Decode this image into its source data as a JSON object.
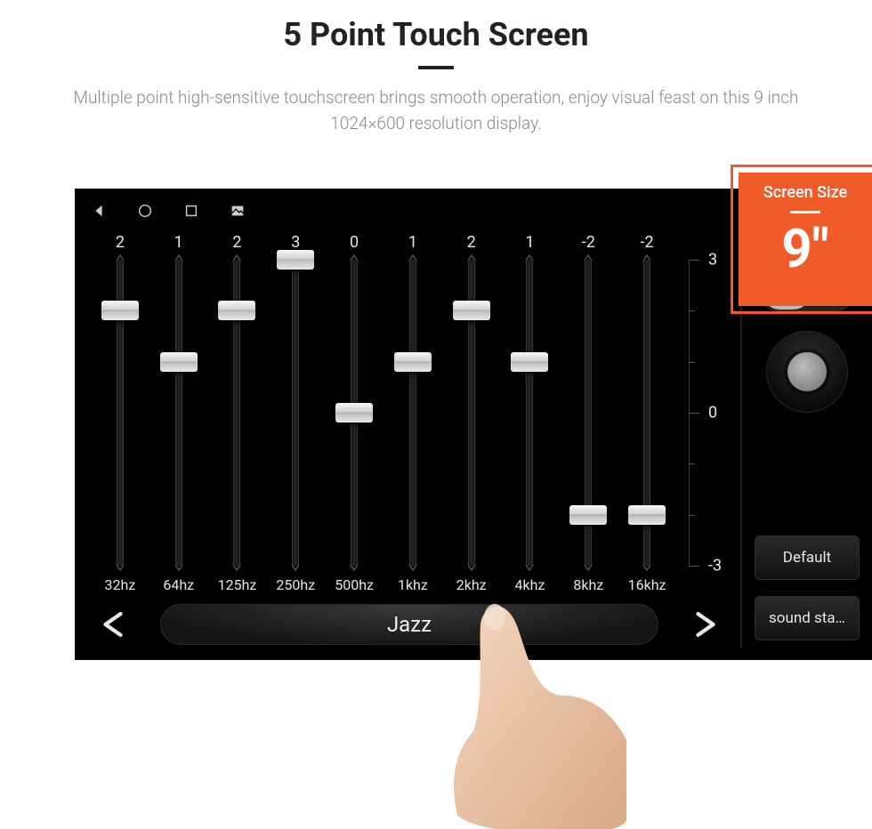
{
  "page": {
    "title": "5 Point Touch Screen",
    "subtitle": "Multiple point high-sensitive touchscreen brings smooth operation, enjoy visual feast on this 9 inch 1024×600 resolution display."
  },
  "badge": {
    "label": "Screen Size",
    "value": "9\""
  },
  "equalizer": {
    "scale": {
      "max": "3",
      "mid": "0",
      "min": "-3"
    },
    "bands": [
      {
        "value": "2",
        "num": 2,
        "freq": "32hz"
      },
      {
        "value": "1",
        "num": 1,
        "freq": "64hz"
      },
      {
        "value": "2",
        "num": 2,
        "freq": "125hz"
      },
      {
        "value": "3",
        "num": 3,
        "freq": "250hz"
      },
      {
        "value": "0",
        "num": 0,
        "freq": "500hz"
      },
      {
        "value": "1",
        "num": 1,
        "freq": "1khz"
      },
      {
        "value": "2",
        "num": 2,
        "freq": "2khz"
      },
      {
        "value": "1",
        "num": 1,
        "freq": "4khz"
      },
      {
        "value": "-2",
        "num": -2,
        "freq": "8khz"
      },
      {
        "value": "-2",
        "num": -2,
        "freq": "16khz"
      }
    ],
    "preset": "Jazz"
  },
  "side": {
    "toggle_hint": "o",
    "default_btn": "Default",
    "sound_btn": "sound sta…"
  }
}
